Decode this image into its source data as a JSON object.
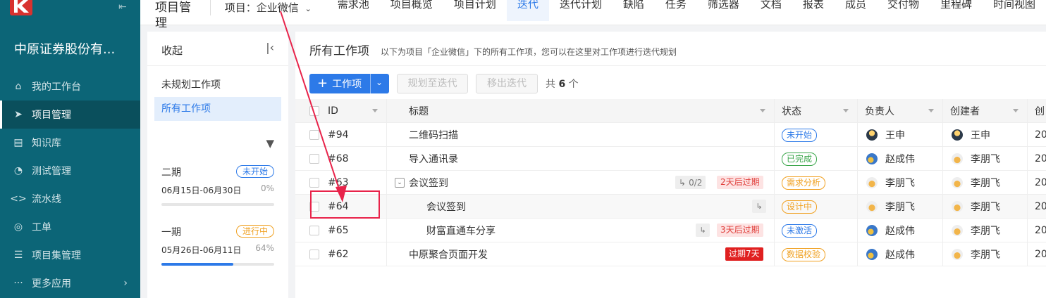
{
  "sidebar": {
    "org_name": "中原证券股份有...",
    "items": [
      {
        "label": "我的工作台",
        "icon": "home-icon"
      },
      {
        "label": "项目管理",
        "icon": "rocket-icon"
      },
      {
        "label": "知识库",
        "icon": "doc-icon"
      },
      {
        "label": "测试管理",
        "icon": "test-icon"
      },
      {
        "label": "流水线",
        "icon": "code-icon"
      },
      {
        "label": "工单",
        "icon": "ticket-icon"
      },
      {
        "label": "项目集管理",
        "icon": "program-icon"
      },
      {
        "label": "更多应用",
        "icon": "more-icon"
      }
    ]
  },
  "topbar": {
    "title": "项目管理",
    "project_selector": "项目：企业微信",
    "tabs": [
      "需求池",
      "项目概览",
      "项目计划",
      "迭代",
      "迭代计划",
      "缺陷",
      "任务",
      "筛选器",
      "文档",
      "报表",
      "成员",
      "交付物",
      "里程碑",
      "时间视图"
    ],
    "active_tab": "迭代"
  },
  "iterpanel": {
    "header": "收起",
    "unplanned": "未规划工作项",
    "all_items": "所有工作项",
    "iterations": [
      {
        "name": "二期",
        "status": "未开始",
        "status_color": "#2d7ae8",
        "dates": "06月15日-06月30日",
        "progress_label": "0%",
        "progress": 0
      },
      {
        "name": "一期",
        "status": "进行中",
        "status_color": "#f0a020",
        "dates": "05月26日-06月11日",
        "progress_label": "64%",
        "progress": 0.64
      }
    ]
  },
  "main": {
    "title": "所有工作项",
    "description": "以下为项目「企业微信」下的所有工作项，您可以在这里对工作项进行迭代规划",
    "new_button": "工作项",
    "plan_button": "规划至迭代",
    "remove_button": "移出迭代",
    "total_prefix": "共",
    "total_count": "6",
    "total_suffix": "个",
    "columns": {
      "id": "ID",
      "title": "标题",
      "status": "状态",
      "assignee": "负责人",
      "creator": "创建者",
      "created": "创"
    },
    "rows": [
      {
        "id": "#94",
        "title": "二维码扫描",
        "status": "未开始",
        "status_color": "#2d7ae8",
        "assignee": "王申",
        "assignee_avatar": "dark",
        "creator": "王申",
        "creator_avatar": "dark",
        "created": "20"
      },
      {
        "id": "#68",
        "title": "导入通讯录",
        "status": "已完成",
        "status_color": "#3aa64a",
        "assignee": "赵成伟",
        "assignee_avatar": "blue",
        "creator": "李朋飞",
        "creator_avatar": "light",
        "created": "20"
      },
      {
        "id": "#63",
        "title": "会议签到",
        "status": "需求分析",
        "status_color": "#f0a020",
        "assignee": "李朋飞",
        "assignee_avatar": "light",
        "creator": "李朋飞",
        "creator_avatar": "light",
        "created": "20",
        "subtasks": "0/2",
        "due": "2天后过期"
      },
      {
        "id": "#64",
        "title": "会议签到",
        "status": "设计中",
        "status_color": "#f0a020",
        "assignee": "李朋飞",
        "assignee_avatar": "light",
        "creator": "李朋飞",
        "creator_avatar": "light",
        "created": "20"
      },
      {
        "id": "#65",
        "title": "财富直通车分享",
        "status": "未激活",
        "status_color": "#2d7ae8",
        "assignee": "赵成伟",
        "assignee_avatar": "blue",
        "creator": "李朋飞",
        "creator_avatar": "light",
        "created": "20",
        "due": "3天后过期"
      },
      {
        "id": "#62",
        "title": "中原聚合页面开发",
        "status": "数据校验",
        "status_color": "#f0a020",
        "assignee": "赵成伟",
        "assignee_avatar": "blue",
        "creator": "李朋飞",
        "creator_avatar": "light",
        "created": "20",
        "due": "过期7天"
      }
    ]
  },
  "annotation": {
    "color": "#e8234a"
  }
}
